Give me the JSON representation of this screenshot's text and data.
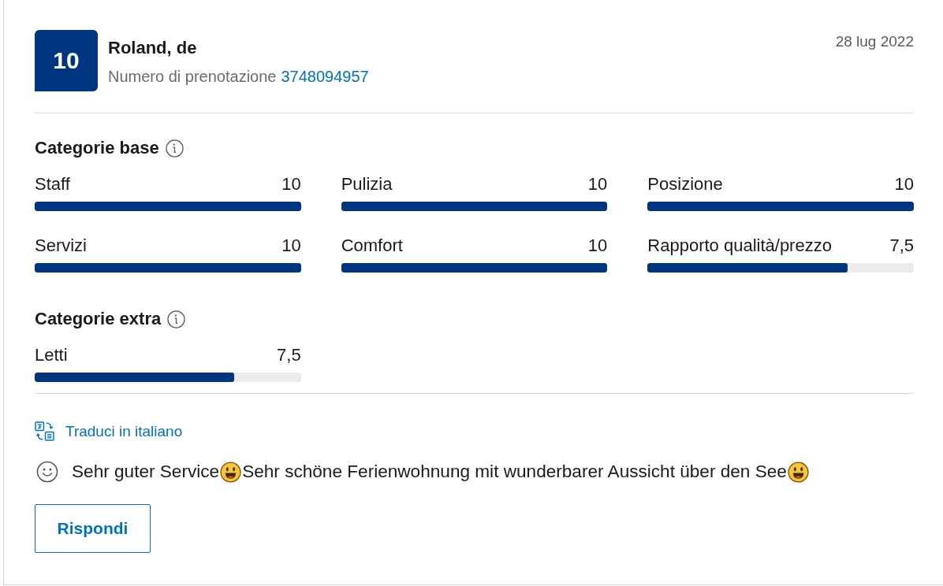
{
  "review": {
    "score": "10",
    "reviewer_name": "Roland, de",
    "booking_number_label": "Numero di prenotazione",
    "booking_number": "3748094957",
    "date": "28 lug 2022",
    "category_groups": [
      {
        "title": "Categorie base",
        "categories": [
          {
            "name": "Staff",
            "score": "10",
            "level": 1
          },
          {
            "name": "Pulizia",
            "score": "10",
            "level": 1
          },
          {
            "name": "Posizione",
            "score": "10",
            "level": 1
          },
          {
            "name": "Servizi",
            "score": "10",
            "level": 1
          },
          {
            "name": "Comfort",
            "score": "10",
            "level": 1
          },
          {
            "name": "Rapporto qualità/prezzo",
            "score": "7,5",
            "level": 0.75
          }
        ]
      },
      {
        "title": "Categorie extra",
        "categories": [
          {
            "name": "Letti",
            "score": "7,5",
            "level": 0.75
          }
        ]
      }
    ],
    "translate_link": "Traduci in italiano",
    "comment": {
      "segments": [
        {
          "kind": "text",
          "text": "Sehr guter Service"
        },
        {
          "kind": "emoji"
        },
        {
          "kind": "text",
          "text": "Sehr schöne Ferienwohnung mit wunderbarer Aussicht über den See"
        },
        {
          "kind": "emoji"
        }
      ]
    },
    "reply_button": "Rispondi"
  }
}
